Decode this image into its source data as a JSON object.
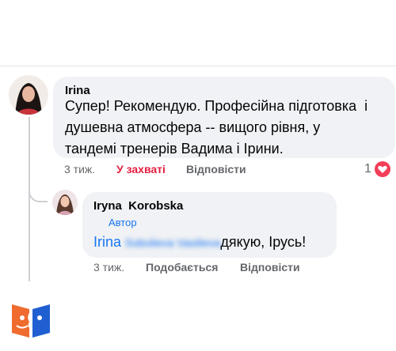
{
  "comment": {
    "author": "Irina",
    "text_lines": [
      "Супер! Рекомендую. Професійна підготовка  і",
      "душевна атмосфера -- вищого рівня, у",
      "тандемі тренерів Вадима і Ірини."
    ],
    "time": "3 тиж.",
    "reaction_label": "У захваті",
    "reply_label": "Відповісти",
    "reaction_count": "1"
  },
  "reply": {
    "author": "Iryna  Korobska",
    "badge": "Автор",
    "mention": "Irina",
    "mention_hidden": "Sobolieva Vasilieva",
    "text": "дякую, Ірусь!",
    "time": "3 тиж.",
    "like_label": "Подобається",
    "reply_label": "Відповісти"
  },
  "colors": {
    "accent": "#1876f2",
    "love": "#e41e3f",
    "bubble": "#f0f2f5",
    "muted": "#65676b"
  },
  "icons": [
    "heart-reaction-icon",
    "logo-book-icon"
  ]
}
